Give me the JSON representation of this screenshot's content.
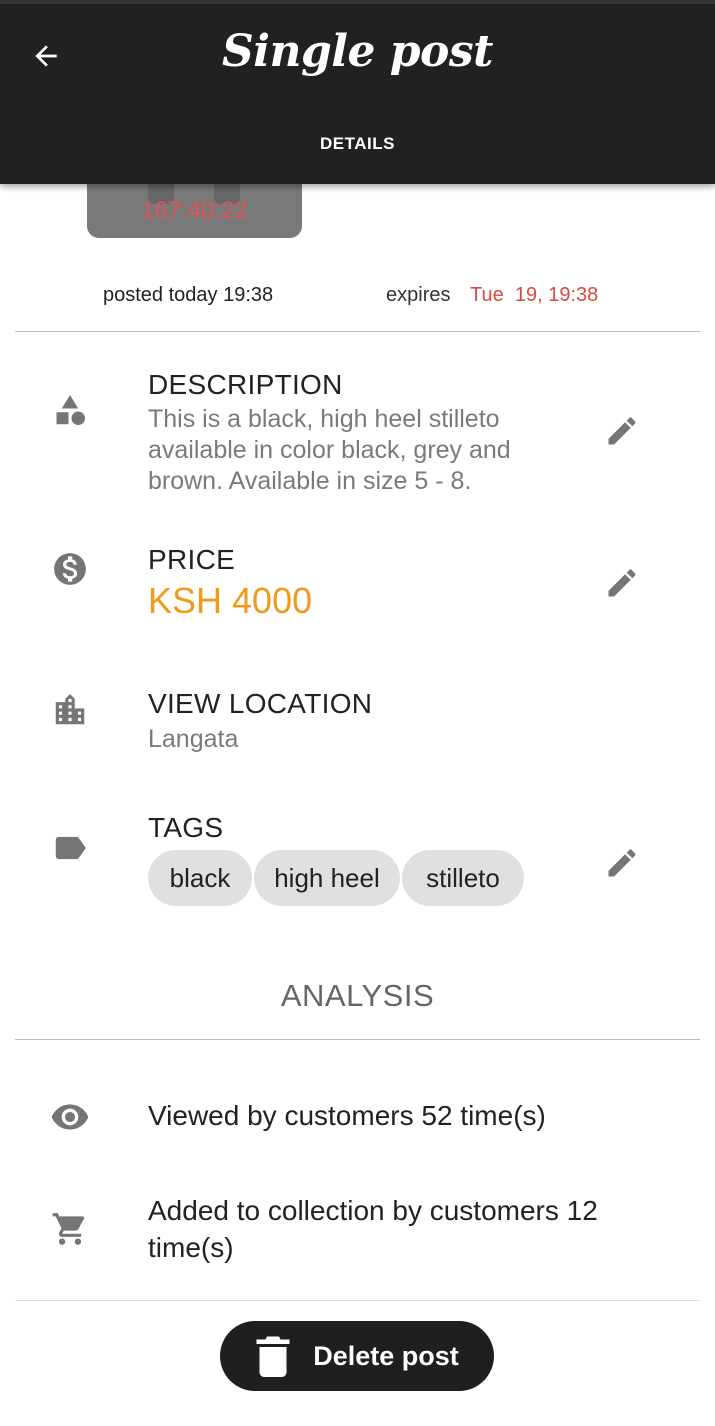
{
  "header": {
    "title": "Single post",
    "tab_label": "DETAILS",
    "back_icon": "arrow-left-icon"
  },
  "post": {
    "countdown": "167:40:22",
    "posted": "posted today 19:38",
    "expires_label": "expires",
    "expires_value": "Tue  19, 19:38"
  },
  "details": {
    "description": {
      "label": "DESCRIPTION",
      "text": "This is a black, high heel stilleto available in color black, grey and brown. Available in size 5 - 8.",
      "icon": "shapes-icon"
    },
    "price": {
      "label": "PRICE",
      "value": "KSH 4000",
      "icon": "dollar-circle-icon"
    },
    "location": {
      "label": "VIEW LOCATION",
      "value": "Langata",
      "icon": "building-icon"
    },
    "tags": {
      "label": "TAGS",
      "icon": "tag-icon",
      "items": [
        "black",
        "high heel",
        "stilleto"
      ]
    }
  },
  "analysis": {
    "title": "ANALYSIS",
    "views": "Viewed by customers 52 time(s)",
    "collections": "Added to collection by customers 12 time(s)"
  },
  "actions": {
    "delete_label": "Delete post",
    "delete_icon": "trash-icon"
  },
  "colors": {
    "appbar": "#212121",
    "price": "#ef9a1b",
    "expires": "#d44b3f",
    "countdown": "#e05454",
    "icon_gray": "#757575"
  }
}
